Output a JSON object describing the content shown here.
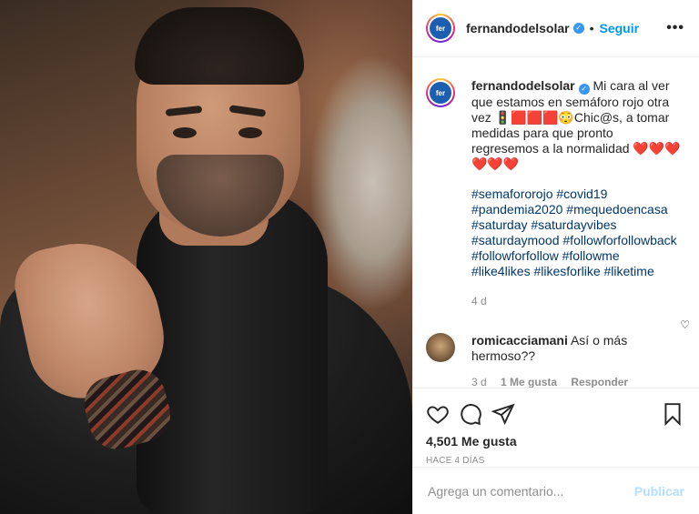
{
  "post": {
    "username": "fernandodelsolar",
    "avatar_label": "fer",
    "follow_label": "Seguir",
    "more_label": "•••"
  },
  "caption": {
    "username": "fernandodelsolar",
    "text": "Mi cara al ver que estamos en semáforo rojo otra vez 🚦🟥🟥🟥😳Chic@s, a tomar medidas para que pronto regresemos a la normalidad ❤️❤️❤️❤️❤️❤️",
    "hashtags": "#semafororojo #covid19 #pandemia2020 #mequedoencasa #saturday #saturdayvibes #saturdaymood #followforfollowback #followforfollow #followme #like4likes #likesforlike #liketime",
    "age": "4 d"
  },
  "comment": {
    "username": "romicacciamani",
    "text": "Así o más hermoso??",
    "age": "3 d",
    "likes": "1 Me gusta",
    "reply": "Responder"
  },
  "stats": {
    "likes": "4,501 Me gusta",
    "time": "HACE 4 DÍAS"
  },
  "add_comment": {
    "placeholder": "Agrega un comentario...",
    "post_label": "Publicar"
  },
  "colors": {
    "link": "#0095f6",
    "hashtag": "#00376b",
    "muted": "#8e8e8e"
  }
}
